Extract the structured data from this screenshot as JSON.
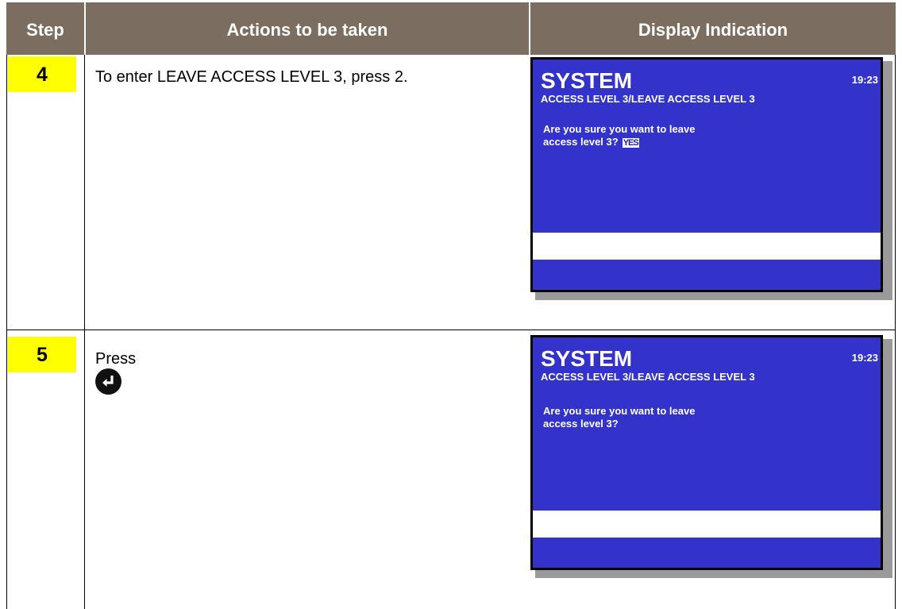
{
  "header": {
    "step": "Step",
    "actions": "Actions to be taken",
    "display": "Display Indication"
  },
  "rows": [
    {
      "step": "4",
      "action": "To enter LEAVE ACCESS LEVEL 3, press 2.",
      "display": {
        "title": "SYSTEM",
        "time": "19:23",
        "path": "ACCESS LEVEL 3/LEAVE ACCESS LEVEL 3",
        "line1": "Are you sure you want to leave",
        "line2": "access level 3?",
        "selection": "YES"
      }
    },
    {
      "step": "5",
      "action": "Press",
      "action_icon": "enter-key-icon",
      "display": {
        "title": "SYSTEM",
        "time": "19:23",
        "path": "ACCESS LEVEL 3/LEAVE ACCESS LEVEL 3",
        "line1": "Are you sure you want to leave",
        "line2": "access level 3?"
      }
    }
  ],
  "colors": {
    "header_bg": "#7b6e60",
    "step_badge": "#ffff00",
    "lcd_bg": "#3333cc"
  }
}
